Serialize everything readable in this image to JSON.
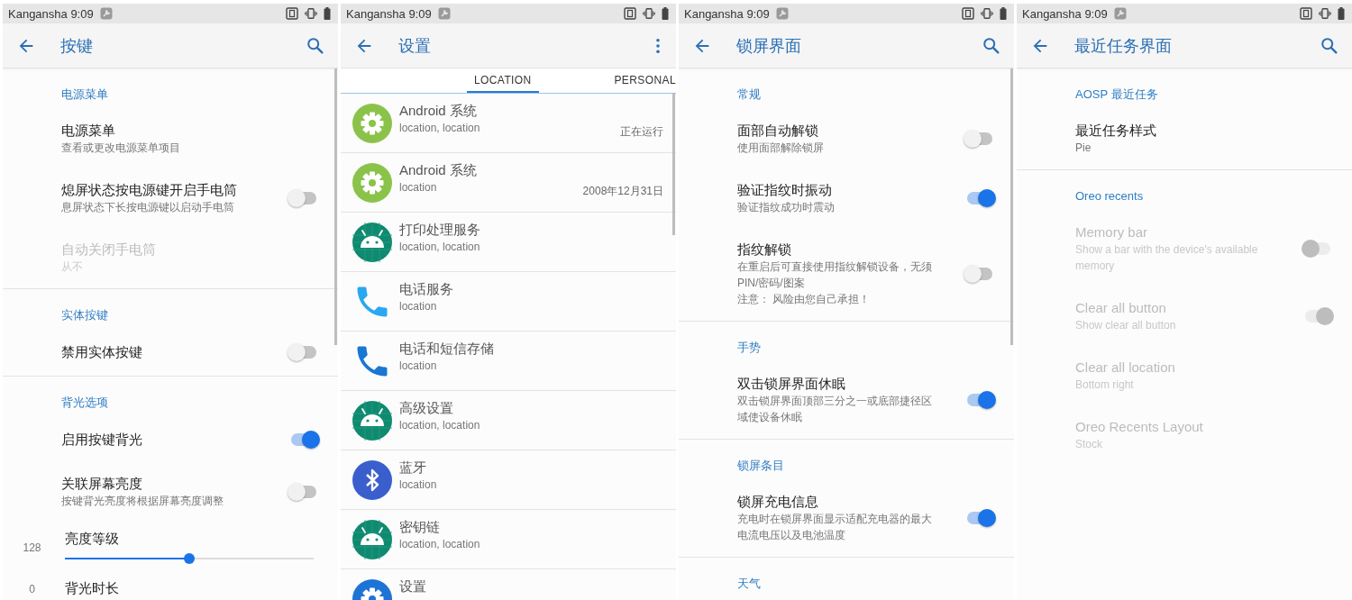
{
  "screens": [
    {
      "status_bar": {
        "carrier_time": "Kangansha 9:09"
      },
      "app_bar": {
        "title": "按键"
      },
      "sections": [
        {
          "header": "电源菜单",
          "items": [
            {
              "kind": "pref",
              "title": "电源菜单",
              "summary": "查看或更改电源菜单项目",
              "disabled": false
            },
            {
              "kind": "pref",
              "title": "熄屏状态按电源键开启手电筒",
              "summary": "息屏状态下长按电源键以启动手电筒",
              "disabled": false,
              "switch_on": false
            },
            {
              "kind": "pref",
              "title": "自动关闭手电筒",
              "summary": "从不",
              "disabled": true
            }
          ]
        },
        {
          "header": "实体按键",
          "items": [
            {
              "kind": "pref",
              "title": "禁用实体按键",
              "disabled": false,
              "switch_on": false
            }
          ]
        },
        {
          "header": "背光选项",
          "items": [
            {
              "kind": "pref",
              "title": "启用按键背光",
              "disabled": false,
              "switch_on": true
            },
            {
              "kind": "pref",
              "title": "关联屏幕亮度",
              "summary": "按键背光亮度将根据屏幕亮度调整",
              "disabled": false,
              "switch_on": false
            },
            {
              "kind": "slider",
              "title": "亮度等级",
              "value": "128",
              "level": 0.5
            },
            {
              "kind": "slider",
              "title": "背光时长",
              "value": "0"
            }
          ]
        }
      ]
    },
    {
      "status_bar": {
        "carrier_time": "Kangansha 9:09"
      },
      "app_bar": {
        "title": "设置"
      },
      "tabs": [
        {
          "label": "LOCATION",
          "selected": true
        },
        {
          "label": "PERSONAL",
          "selected": false
        }
      ],
      "apps": [
        {
          "kind": "gear",
          "title": "Android 系统",
          "subtitle": "location, location",
          "status": "正在运行"
        },
        {
          "kind": "gear",
          "title": "Android 系统",
          "subtitle": "location",
          "status": "2008年12月31日"
        },
        {
          "kind": "android",
          "title": "打印处理服务",
          "subtitle": "location, location"
        },
        {
          "kind": "phone",
          "title": "电话服务",
          "subtitle": "location"
        },
        {
          "kind": "phone_glossy",
          "title": "电话和短信存储",
          "subtitle": "location"
        },
        {
          "kind": "android",
          "title": "高级设置",
          "subtitle": "location, location"
        },
        {
          "kind": "bluetooth",
          "title": "蓝牙",
          "subtitle": "location"
        },
        {
          "kind": "android",
          "title": "密钥链",
          "subtitle": "location, location"
        },
        {
          "kind": "gear_blue",
          "title": "设置"
        }
      ]
    },
    {
      "status_bar": {
        "carrier_time": "Kangansha 9:09"
      },
      "app_bar": {
        "title": "锁屏界面"
      },
      "sections": [
        {
          "header": "常规",
          "items": [
            {
              "kind": "pref",
              "title": "面部自动解锁",
              "summary": "使用面部解除锁屏",
              "disabled": false,
              "switch_on": false
            },
            {
              "kind": "pref",
              "title": "验证指纹时振动",
              "summary": "验证指纹成功时震动",
              "disabled": false,
              "switch_on": true
            },
            {
              "kind": "pref",
              "title": "指纹解锁",
              "summary": "在重启后可直接使用指纹解锁设备，无须PIN/密码/图案",
              "note": "注意： 风险由您自己承担！",
              "disabled": false,
              "switch_on": false
            }
          ]
        },
        {
          "header": "手势",
          "items": [
            {
              "kind": "pref",
              "title": "双击锁屏界面休眠",
              "summary": "双击锁屏界面顶部三分之一或底部捷径区域使设备休眠",
              "disabled": false,
              "switch_on": true
            }
          ]
        },
        {
          "header": "锁屏条目",
          "items": [
            {
              "kind": "pref",
              "title": "锁屏充电信息",
              "summary": "充电时在锁屏界面显示适配充电器的最大电流电压以及电池温度",
              "disabled": false,
              "switch_on": true
            }
          ]
        },
        {
          "header": "天气"
        }
      ]
    },
    {
      "status_bar": {
        "carrier_time": "Kangansha 9:09"
      },
      "app_bar": {
        "title": "最近任务界面"
      },
      "sections": [
        {
          "header": "AOSP 最近任务",
          "items": [
            {
              "kind": "pref",
              "title": "最近任务样式",
              "summary": "Pie",
              "disabled": false
            }
          ]
        },
        {
          "header": "Oreo recents",
          "items": [
            {
              "kind": "pref",
              "title": "Memory bar",
              "summary": "Show a bar with the device's available memory",
              "disabled": true,
              "switch_on": false
            },
            {
              "kind": "pref",
              "title": "Clear all button",
              "summary": "Show clear all button",
              "disabled": true,
              "switch_on": true
            },
            {
              "kind": "pref",
              "title": "Clear all location",
              "summary": "Bottom right",
              "disabled": true
            },
            {
              "kind": "pref",
              "title": "Oreo Recents Layout",
              "summary": "Stock",
              "disabled": true
            }
          ]
        }
      ]
    }
  ]
}
